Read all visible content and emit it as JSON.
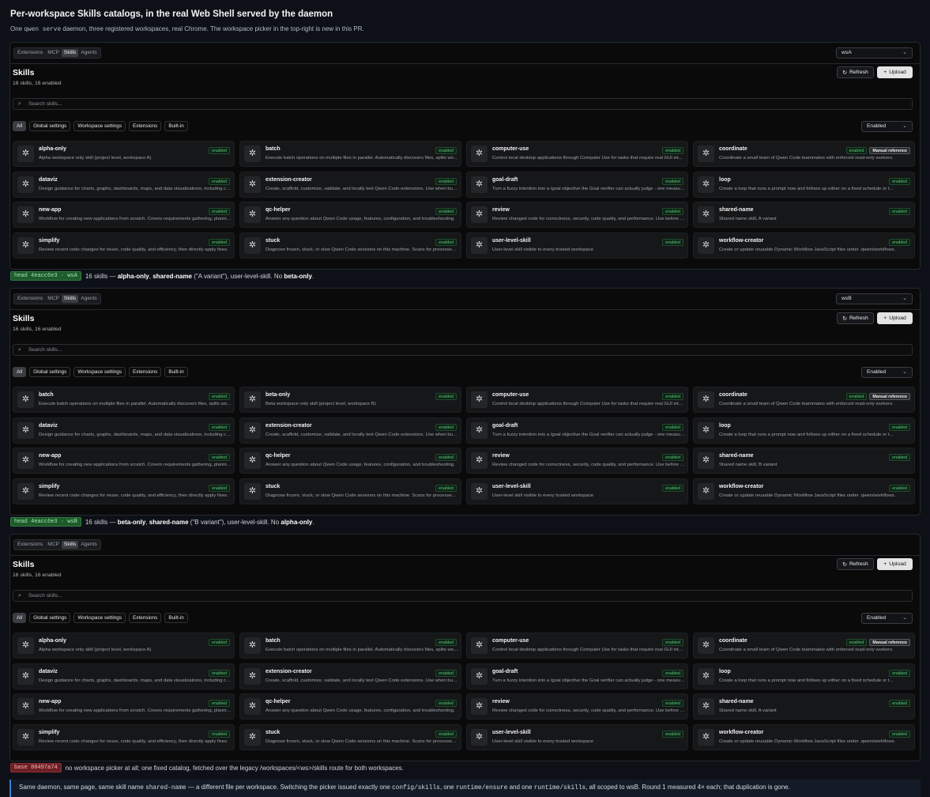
{
  "header": {
    "title": "Per-workspace Skills catalogs, in the real Web Shell served by the daemon",
    "subtitle_prefix": "One ",
    "subtitle_code": "qwen serve",
    "subtitle_suffix": " daemon, three registered workspaces, real Chrome. The workspace picker in the top-right is new in this PR."
  },
  "tabs": [
    "Extensions",
    "MCP",
    "Skills",
    "Agents"
  ],
  "active_tab": "Skills",
  "ui": {
    "skills_title": "Skills",
    "skills_count": "16 skills, 16 enabled",
    "refresh": "Refresh",
    "upload": "Upload",
    "search_placeholder": "Search skills...",
    "filters": [
      "All",
      "Global settings",
      "Workspace settings",
      "Extensions",
      "Built-in"
    ],
    "status_filter": "Enabled",
    "enabled_badge": "enabled",
    "manual_badge": "Manual reference"
  },
  "colors": {
    "enabled_badge": "#5cc77a",
    "head_tag": "#1f5a2c",
    "base_tag": "#6b2023",
    "note_accent": "#3a7bd5"
  },
  "panels": [
    {
      "picker": "wsA",
      "skills": [
        {
          "name": "alpha-only",
          "desc": "Alpha workspace only skill (project level, workspace A)"
        },
        {
          "name": "batch",
          "desc": "Execute batch operations on multiple files in parallel. Automatically discovers files, splits work into chunks and runs them concurrently."
        },
        {
          "name": "computer-use",
          "desc": "Control local desktop applications through Computer Use for tasks that require real GUI interaction."
        },
        {
          "name": "coordinate",
          "desc": "Coordinate a small team of Qwen Code teammates with enforced read-only workers.",
          "manual": true
        },
        {
          "name": "dataviz",
          "desc": "Design guidance for charts, graphs, dashboards, maps, and data visualizations, including color and layout."
        },
        {
          "name": "extension-creator",
          "desc": "Create, scaffold, customize, validate, and locally test Qwen Code extensions. Use when building a new extension."
        },
        {
          "name": "goal-draft",
          "desc": "Turn a fuzzy intention into a /goal objective the Goal verifier can actually judge - one measurable outcome."
        },
        {
          "name": "loop",
          "desc": "Create a loop that runs a prompt now and follows up either on a fixed schedule or t..."
        },
        {
          "name": "new-app",
          "desc": "Workflow for creating new applications from scratch. Covers requirements gathering, planning and scaffolding."
        },
        {
          "name": "qc-helper",
          "desc": "Answer any question about Qwen Code usage, features, configuration, and troubleshooting."
        },
        {
          "name": "review",
          "desc": "Review changed code for correctness, security, code quality, and performance. Use before merging."
        },
        {
          "name": "shared-name",
          "desc": "Shared name skill, A variant"
        },
        {
          "name": "simplify",
          "desc": "Review recent code changes for reuse, code quality, and efficiency, then directly apply fixes."
        },
        {
          "name": "stuck",
          "desc": "Diagnose frozen, stuck, or slow Qwen Code sessions on this machine. Scans for processes and logs."
        },
        {
          "name": "user-level-skill",
          "desc": "User-level skill visible to every trusted workspace"
        },
        {
          "name": "workflow-creator",
          "desc": "Create or update reusable Dynamic Workflow JavaScript files under .qwen/workflows."
        }
      ]
    },
    {
      "picker": "wsB",
      "skills": [
        {
          "name": "batch",
          "desc": "Execute batch operations on multiple files in parallel. Automatically discovers files, splits work into chunks and runs them concurrently."
        },
        {
          "name": "beta-only",
          "desc": "Beta workspace only skill (project level, workspace B)"
        },
        {
          "name": "computer-use",
          "desc": "Control local desktop applications through Computer Use for tasks that require real GUI interaction."
        },
        {
          "name": "coordinate",
          "desc": "Coordinate a small team of Qwen Code teammates with enforced read-only workers.",
          "manual": true
        },
        {
          "name": "dataviz",
          "desc": "Design guidance for charts, graphs, dashboards, maps, and data visualizations, including color and layout."
        },
        {
          "name": "extension-creator",
          "desc": "Create, scaffold, customize, validate, and locally test Qwen Code extensions. Use when building a new extension."
        },
        {
          "name": "goal-draft",
          "desc": "Turn a fuzzy intention into a /goal objective the Goal verifier can actually judge - one measurable outcome."
        },
        {
          "name": "loop",
          "desc": "Create a loop that runs a prompt now and follows up either on a fixed schedule or t..."
        },
        {
          "name": "new-app",
          "desc": "Workflow for creating new applications from scratch. Covers requirements gathering, planning and scaffolding."
        },
        {
          "name": "qc-helper",
          "desc": "Answer any question about Qwen Code usage, features, configuration, and troubleshooting."
        },
        {
          "name": "review",
          "desc": "Review changed code for correctness, security, code quality, and performance. Use before merging."
        },
        {
          "name": "shared-name",
          "desc": "Shared name skill, B variant"
        },
        {
          "name": "simplify",
          "desc": "Review recent code changes for reuse, code quality, and efficiency, then directly apply fixes."
        },
        {
          "name": "stuck",
          "desc": "Diagnose frozen, stuck, or slow Qwen Code sessions on this machine. Scans for processes and logs."
        },
        {
          "name": "user-level-skill",
          "desc": "User-level skill visible to every trusted workspace"
        },
        {
          "name": "workflow-creator",
          "desc": "Create or update reusable Dynamic Workflow JavaScript files under .qwen/workflows."
        }
      ]
    },
    {
      "picker": null,
      "skills": [
        {
          "name": "alpha-only",
          "desc": "Alpha workspace only skill (project level, workspace A)"
        },
        {
          "name": "batch",
          "desc": "Execute batch operations on multiple files in parallel. Automatically discovers files, splits work into chunks and runs them concurrently."
        },
        {
          "name": "computer-use",
          "desc": "Control local desktop applications through Computer Use for tasks that require real GUI interaction."
        },
        {
          "name": "coordinate",
          "desc": "Coordinate a small team of Qwen Code teammates with enforced read-only workers.",
          "manual": true
        },
        {
          "name": "dataviz",
          "desc": "Design guidance for charts, graphs, dashboards, maps, and data visualizations, including color and layout."
        },
        {
          "name": "extension-creator",
          "desc": "Create, scaffold, customize, validate, and locally test Qwen Code extensions. Use when building a new extension."
        },
        {
          "name": "goal-draft",
          "desc": "Turn a fuzzy intention into a /goal objective the Goal verifier can actually judge - one measurable outcome."
        },
        {
          "name": "loop",
          "desc": "Create a loop that runs a prompt now and follows up either on a fixed schedule or t..."
        },
        {
          "name": "new-app",
          "desc": "Workflow for creating new applications from scratch. Covers requirements gathering, planning and scaffolding."
        },
        {
          "name": "qc-helper",
          "desc": "Answer any question about Qwen Code usage, features, configuration, and troubleshooting."
        },
        {
          "name": "review",
          "desc": "Review changed code for correctness, security, code quality, and performance. Use before merging."
        },
        {
          "name": "shared-name",
          "desc": "Shared name skill, A variant"
        },
        {
          "name": "simplify",
          "desc": "Review recent code changes for reuse, code quality, and efficiency, then directly apply fixes."
        },
        {
          "name": "stuck",
          "desc": "Diagnose frozen, stuck, or slow Qwen Code sessions on this machine. Scans for processes and logs."
        },
        {
          "name": "user-level-skill",
          "desc": "User-level skill visible to every trusted workspace"
        },
        {
          "name": "workflow-creator",
          "desc": "Create or update reusable Dynamic Workflow JavaScript files under .qwen/workflows."
        }
      ]
    }
  ],
  "captions": [
    {
      "tag": "head 4eacc6e3 · wsA",
      "kind": "green",
      "parts": [
        [
          "16 skills — ",
          false
        ],
        [
          "alpha-only",
          true
        ],
        [
          ", ",
          false
        ],
        [
          "shared-name",
          true
        ],
        [
          " (\"A variant\"), user-level-skill. No ",
          false
        ],
        [
          "beta-only",
          true
        ],
        [
          ".",
          false
        ]
      ]
    },
    {
      "tag": "head 4eacc6e3 · wsB",
      "kind": "green",
      "parts": [
        [
          "16 skills — ",
          false
        ],
        [
          "beta-only",
          true
        ],
        [
          ", ",
          false
        ],
        [
          "shared-name",
          true
        ],
        [
          " (\"B variant\"), user-level-skill. No ",
          false
        ],
        [
          "alpha-only",
          true
        ],
        [
          ".",
          false
        ]
      ]
    },
    {
      "tag": "base 80497a74",
      "kind": "red",
      "parts": [
        [
          "no workspace picker at all; one fixed catalog, fetched over the legacy ",
          false
        ],
        [
          "/workspaces/<ws>/skills",
          false
        ],
        [
          " route for both workspaces.",
          false
        ]
      ]
    }
  ],
  "note": {
    "parts": [
      [
        "Same daemon, same page, same skill name ",
        "t"
      ],
      [
        "shared-name",
        "c"
      ],
      [
        " — a different file per workspace. Switching the picker issued exactly one ",
        "t"
      ],
      [
        "config/skills",
        "c"
      ],
      [
        ", one ",
        "t"
      ],
      [
        "runtime/ensure",
        "c"
      ],
      [
        " and one ",
        "t"
      ],
      [
        "runtime/skills",
        "c"
      ],
      [
        ", all scoped to wsB. Round 1 measured 4× each; that duplication is gone.",
        "t"
      ]
    ]
  }
}
